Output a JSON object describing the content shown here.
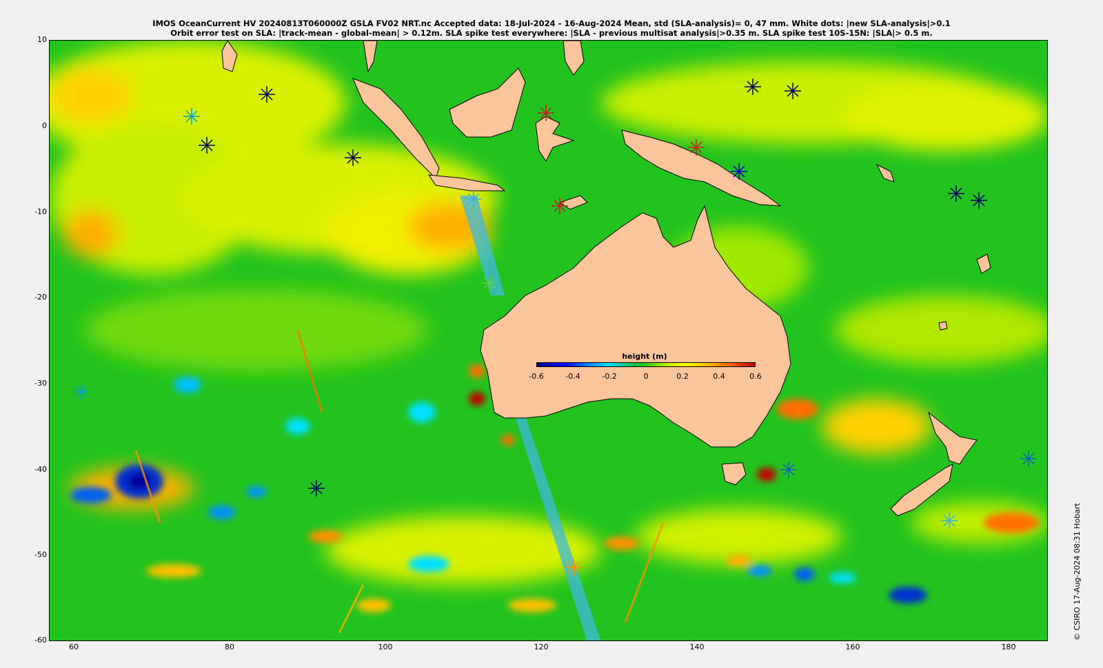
{
  "title": {
    "line1": "IMOS OceanCurrent HV 20240813T060000Z GSLA FV02 NRT.nc  Accepted data: 18-Jul-2024 - 16-Aug-2024 Mean, std (SLA-analysis)= 0, 47 mm. White dots: |new SLA-analysis|>0.1",
    "line2": "Orbit error test on SLA: |track-mean  - global-mean| > 0.12m.  SLA spike test everywhere: |SLA - previous multisat analysis|>0.35 m. SLA spike test 10S-15N: |SLA|> 0.5 m."
  },
  "map": {
    "lon_range": [
      57,
      185
    ],
    "lat_range": [
      -60,
      10
    ],
    "x_ticks": [
      "60",
      "80",
      "100",
      "120",
      "140",
      "160",
      "180"
    ],
    "y_ticks": [
      "10",
      "0",
      "-10",
      "-20",
      "-30",
      "-40",
      "-50",
      "-60"
    ],
    "ocean_color": "#22c31e",
    "land_color": "#fac59a"
  },
  "colorbar": {
    "label": "height (m)",
    "ticks": [
      "-0.6",
      "-0.4",
      "-0.2",
      "0",
      "0.2",
      "0.4",
      "0.6"
    ],
    "range": [
      -0.6,
      0.6
    ]
  },
  "copyright": "© CSIRO 17-Aug-2024 08:31 Hobart"
}
